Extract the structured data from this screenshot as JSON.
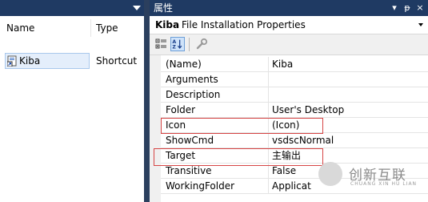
{
  "left_pane": {
    "columns": [
      "Name",
      "Type"
    ],
    "file": {
      "name": "Kiba",
      "type": "Shortcut"
    }
  },
  "properties": {
    "title": "属性",
    "title_buttons": [
      "▾",
      "ᵽ",
      "×"
    ],
    "object_name": "Kiba",
    "object_type": "File Installation Properties",
    "rows": [
      {
        "name": "(Name)",
        "value": "Kiba"
      },
      {
        "name": "Arguments",
        "value": ""
      },
      {
        "name": "Description",
        "value": ""
      },
      {
        "name": "Folder",
        "value": "User's Desktop"
      },
      {
        "name": "Icon",
        "value": "(Icon)"
      },
      {
        "name": "ShowCmd",
        "value": "vsdscNormal"
      },
      {
        "name": "Target",
        "value": "主输出"
      },
      {
        "name": "Transitive",
        "value": "False"
      },
      {
        "name": "WorkingFolder",
        "value": "Applicat"
      }
    ]
  },
  "watermark": {
    "title": "创新互联",
    "subtitle": "CHUANG XIN HU LIAN"
  },
  "colors": {
    "titlebar": "#1f3a63",
    "highlight_box": "#d64545",
    "selection": "#e4eefb"
  }
}
